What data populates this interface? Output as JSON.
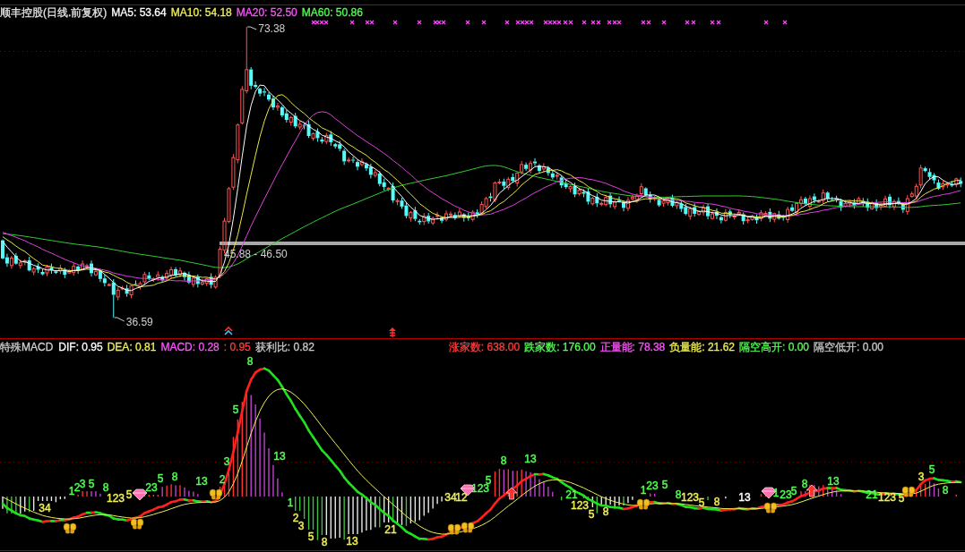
{
  "price_panel": {
    "title": "顺丰控股(日线.前复权)",
    "legend": [
      {
        "text": "MA5: 53.64",
        "color": "#ffffff"
      },
      {
        "text": "MA10: 54.18",
        "color": "#f0f054"
      },
      {
        "text": "MA20: 52.50",
        "color": "#ff54ff"
      },
      {
        "text": "MA60: 50.86",
        "color": "#54ff54"
      }
    ],
    "annotations": [
      {
        "kind": "high",
        "text": "73.38"
      },
      {
        "kind": "low",
        "text": "36.59"
      },
      {
        "kind": "gap",
        "text": "45.88 - 46.50"
      }
    ]
  },
  "indicator_panel": {
    "title": "特殊MACD",
    "legend": [
      {
        "text": "DIF: 0.95",
        "color": "#ffffff"
      },
      {
        "text": "DEA: 0.81",
        "color": "#f0f054"
      },
      {
        "text": "MACD: 0.28",
        "color": "#ff54ff"
      },
      {
        "text": ": 0.95",
        "color": "#ff3c3c"
      },
      {
        "text": "获利比: 0.82",
        "color": "#c8c8c8"
      }
    ],
    "market_stats": [
      {
        "text": "涨家数: 638.00",
        "color": "#ff3c3c"
      },
      {
        "text": "跌家数: 176.00",
        "color": "#54ff54"
      },
      {
        "text": "正量能: 78.38",
        "color": "#ff54ff"
      },
      {
        "text": "负量能: 21.62",
        "color": "#f0f054"
      },
      {
        "text": "隔空高开: 0.00",
        "color": "#54ff54"
      },
      {
        "text": "隔空低开: 0.00",
        "color": "#c8c8c8"
      }
    ],
    "count_labels": [
      {
        "text": "34",
        "color": "#f0f054"
      },
      {
        "text": "1",
        "color": "#54ff54"
      },
      {
        "text": "2",
        "color": "#54ff54"
      },
      {
        "text": "3",
        "color": "#54ff54"
      },
      {
        "text": "5",
        "color": "#54ff54"
      },
      {
        "text": "8",
        "color": "#54ff54"
      },
      {
        "text": "123",
        "color": "#f0f054"
      },
      {
        "text": "5",
        "color": "#f0f054"
      },
      {
        "text": "23",
        "color": "#54ff54"
      },
      {
        "text": "5",
        "color": "#54ff54"
      },
      {
        "text": "8",
        "color": "#54ff54"
      },
      {
        "text": "13",
        "color": "#54ff54"
      },
      {
        "text": "2",
        "color": "#54ff54"
      },
      {
        "text": "3",
        "color": "#54ff54"
      },
      {
        "text": "5",
        "color": "#54ff54"
      },
      {
        "text": "8",
        "color": "#54ff54"
      },
      {
        "text": "13",
        "color": "#54ff54"
      },
      {
        "text": "1",
        "color": "#54ff54"
      },
      {
        "text": "2",
        "color": "#f0f054"
      },
      {
        "text": "3",
        "color": "#f0f054"
      },
      {
        "text": "5",
        "color": "#f0f054"
      },
      {
        "text": "8",
        "color": "#f0f054"
      },
      {
        "text": "13",
        "color": "#f0f054"
      },
      {
        "text": "21",
        "color": "#f0f054"
      },
      {
        "text": "34",
        "color": "#f0f054"
      },
      {
        "text": "12",
        "color": "#f0f054"
      },
      {
        "text": "123",
        "color": "#54ff54"
      },
      {
        "text": "5",
        "color": "#54ff54"
      },
      {
        "text": "8",
        "color": "#54ff54"
      },
      {
        "text": "13",
        "color": "#54ff54"
      },
      {
        "text": "21",
        "color": "#54ff54"
      },
      {
        "text": "123",
        "color": "#f0f054"
      },
      {
        "text": "5",
        "color": "#f0f054"
      },
      {
        "text": "8",
        "color": "#f0f054"
      },
      {
        "text": "1",
        "color": "#54ff54"
      },
      {
        "text": "23",
        "color": "#54ff54"
      },
      {
        "text": "5",
        "color": "#54ff54"
      },
      {
        "text": "8",
        "color": "#54ff54"
      },
      {
        "text": "123",
        "color": "#f0f054"
      },
      {
        "text": "5",
        "color": "#f0f054"
      },
      {
        "text": "8",
        "color": "#f0f054"
      },
      {
        "text": "13",
        "color": "#ffffff"
      },
      {
        "text": "1",
        "color": "#54ff54"
      },
      {
        "text": "23",
        "color": "#54ff54"
      },
      {
        "text": "5",
        "color": "#54ff54"
      },
      {
        "text": "8",
        "color": "#54ff54"
      },
      {
        "text": "13",
        "color": "#54ff54"
      },
      {
        "text": "21",
        "color": "#54ff54"
      },
      {
        "text": "123",
        "color": "#f0f054"
      },
      {
        "text": "5",
        "color": "#f0f054"
      },
      {
        "text": "3",
        "color": "#f0f054"
      },
      {
        "text": "5",
        "color": "#54ff54"
      },
      {
        "text": "8",
        "color": "#54ff54"
      }
    ]
  }
}
